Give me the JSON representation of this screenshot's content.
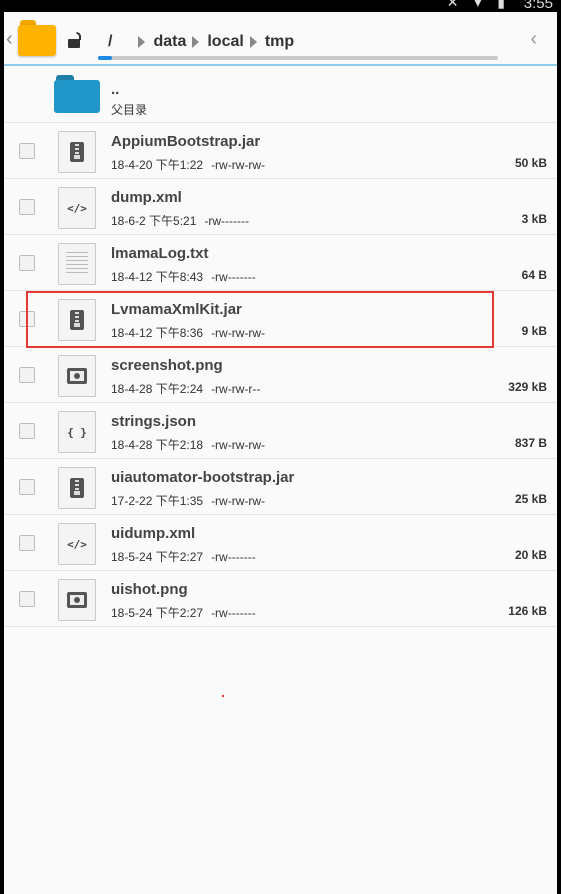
{
  "statusbar": {
    "icons_text": "✕ ▾ ▮",
    "time": "3:55"
  },
  "toolbar": {
    "back_icon": "chevron-left-icon",
    "app_icon": "folder-app-icon",
    "lock_icon": "unlocked-icon",
    "crumbs": {
      "root": "/",
      "items": [
        "data",
        "local",
        "tmp"
      ]
    },
    "forward_icon": "chevron-left-icon"
  },
  "parent": {
    "name": "..",
    "label": "父目录"
  },
  "files": [
    {
      "name": "AppiumBootstrap.jar",
      "date": "18-4-20 下午1:22",
      "perm": "-rw-rw-rw-",
      "size": "50 kB",
      "icon": "jar-icon"
    },
    {
      "name": "dump.xml",
      "date": "18-6-2 下午5:21",
      "perm": "-rw-------",
      "size": "3 kB",
      "icon": "xml-icon"
    },
    {
      "name": "lmamaLog.txt",
      "date": "18-4-12 下午8:43",
      "perm": "-rw-------",
      "size": "64 B",
      "icon": "text-file-icon"
    },
    {
      "name": "LvmamaXmlKit.jar",
      "date": "18-4-12 下午8:36",
      "perm": "-rw-rw-rw-",
      "size": "9 kB",
      "icon": "jar-icon"
    },
    {
      "name": "screenshot.png",
      "date": "18-4-28 下午2:24",
      "perm": "-rw-rw-r--",
      "size": "329 kB",
      "icon": "image-icon"
    },
    {
      "name": "strings.json",
      "date": "18-4-28 下午2:18",
      "perm": "-rw-rw-rw-",
      "size": "837 B",
      "icon": "json-icon"
    },
    {
      "name": "uiautomator-bootstrap.jar",
      "date": "17-2-22 下午1:35",
      "perm": "-rw-rw-rw-",
      "size": "25 kB",
      "icon": "jar-icon"
    },
    {
      "name": "uidump.xml",
      "date": "18-5-24 下午2:27",
      "perm": "-rw-------",
      "size": "20 kB",
      "icon": "xml-icon"
    },
    {
      "name": "uishot.png",
      "date": "18-5-24 下午2:27",
      "perm": "-rw-------",
      "size": "126 kB",
      "icon": "image-icon"
    }
  ],
  "glyphs": {
    "xml": "</>",
    "json": "{ }"
  },
  "colors": {
    "accent": "#1e88e5",
    "folder": "#2196c9",
    "app_icon": "#ffb300",
    "highlight": "#e53935"
  }
}
